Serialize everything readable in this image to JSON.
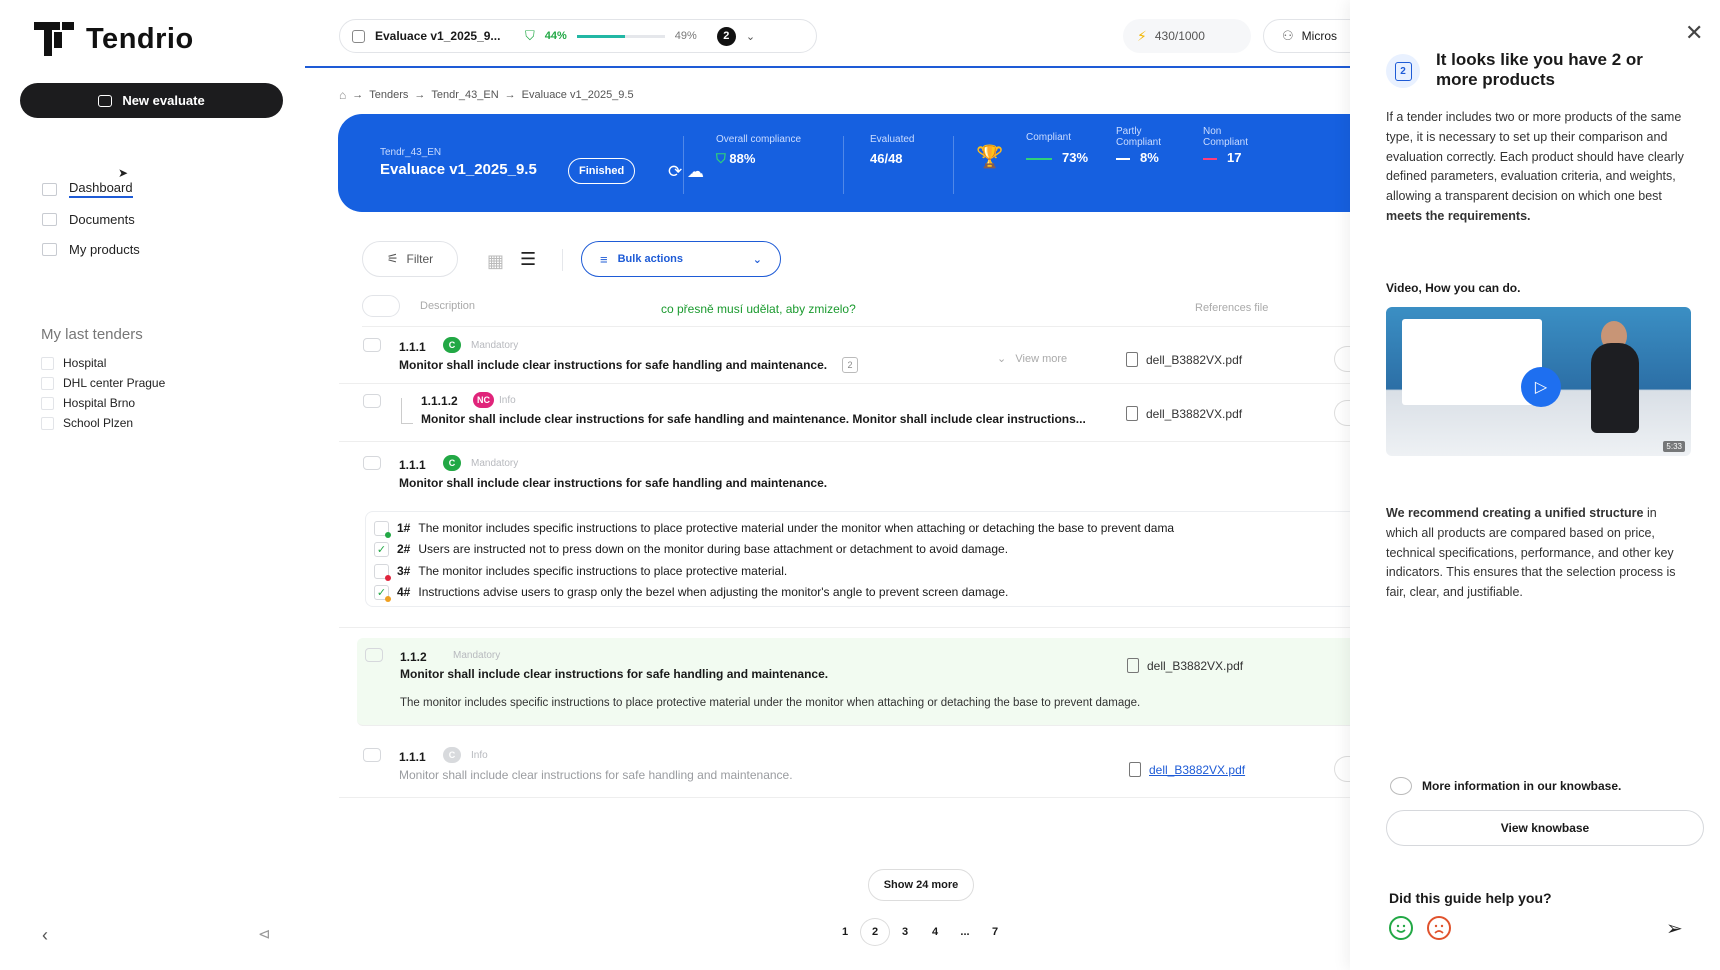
{
  "sidebar": {
    "logo_text": "Tendrio",
    "new_button": "New evaluate",
    "nav": [
      {
        "label": "Dashboard",
        "icon": "dashboard-icon",
        "active": true
      },
      {
        "label": "Documents",
        "icon": "layers-icon",
        "active": false
      },
      {
        "label": "My products",
        "icon": "cart-icon",
        "active": false
      }
    ],
    "section_title": "My last tenders",
    "tenders": [
      "Hospital",
      "DHL center Prague",
      "Hospital Brno",
      "School Plzen"
    ],
    "collapse_icon": "chevron-left-icon",
    "announce_icon": "megaphone-icon"
  },
  "topbar": {
    "eval_name": "Evaluace v1_2025_9...",
    "compliance_pct": "44%",
    "progress_fraction": 0.55,
    "progress_pct": "49%",
    "badge": "2",
    "credits": "430/1000",
    "user": "Micros"
  },
  "breadcrumb": [
    "Tenders",
    "Tendr_43_EN",
    "Evaluace v1_2025_9.5"
  ],
  "banner": {
    "subtitle": "Tendr_43_EN",
    "title": "Evaluace v1_2025_9.5",
    "status": "Finished",
    "overall_label": "Overall compliance",
    "overall_value": "88%",
    "evaluated_label": "Evaluated",
    "evaluated_value": "46/48",
    "compliant_label": "Compliant",
    "compliant_value": "73%",
    "partly_label": "Partly Compliant",
    "partly_value": "8%",
    "non_label": "Non Compliant",
    "non_value": "17",
    "colors": {
      "compliant": "#2fd07a",
      "partly": "#ffffff",
      "non": "#ff3d7a"
    }
  },
  "toolbar": {
    "filter": "Filter",
    "bulk": "Bulk actions"
  },
  "list_header": {
    "description": "Description",
    "references": "References file",
    "note": "co přesně musí udělat, aby zmizelo?"
  },
  "rows": [
    {
      "num": "1.1.1",
      "tag": "C",
      "kind": "Mandatory",
      "text": "Monitor shall include clear instructions for safe handling and maintenance.",
      "count": "2",
      "view_more": "View more",
      "file": "dell_B3882VX.pdf"
    },
    {
      "num": "1.1.1.2",
      "tag": "NC",
      "kind": "Info",
      "text": "Monitor shall include clear instructions for safe handling and maintenance. Monitor shall include clear instructions...",
      "file": "dell_B3882VX.pdf"
    },
    {
      "num": "1.1.1",
      "tag": "C",
      "kind": "Mandatory",
      "text": "Monitor shall include clear instructions for safe handling and maintenance."
    },
    {
      "num": "1.1.2",
      "kind": "Mandatory",
      "text": "Monitor shall include clear instructions for safe handling and maintenance.",
      "detail": "The monitor includes specific instructions to place protective material under the monitor when attaching or detaching the base to prevent damage.",
      "file": "dell_B3882VX.pdf"
    },
    {
      "num": "1.1.1",
      "tag": "C",
      "kind": "Info",
      "text": "Monitor shall include clear instructions for safe handling and maintenance.",
      "file": "dell_B3882VX.pdf"
    }
  ],
  "sub_items": [
    {
      "num": "1#",
      "text": "The monitor includes specific instructions to place protective material under the monitor when attaching or detaching the base to prevent dama",
      "checked": false,
      "dot": "#22a845"
    },
    {
      "num": "2#",
      "text": "Users are instructed not to press down on the monitor during base attachment or detachment to avoid damage.",
      "checked": true,
      "dot": ""
    },
    {
      "num": "3#",
      "text": "The monitor includes specific instructions to place protective material.",
      "checked": false,
      "dot": "#e0243c"
    },
    {
      "num": "4#",
      "text": "Instructions advise users to grasp only the bezel when adjusting the monitor's angle to prevent screen damage.",
      "checked": true,
      "dot": "#f0a020"
    }
  ],
  "pagination": {
    "show_more": "Show 24 more",
    "pages": [
      "1",
      "2",
      "3",
      "4",
      "...",
      "7"
    ],
    "current": "2"
  },
  "panel": {
    "number": "2",
    "title": "It looks like you have 2 or more products",
    "para1_text": "If a tender includes two or more products of the same type, it is necessary to set up their comparison and evaluation correctly. Each product should have clearly defined parameters, evaluation criteria, and weights, allowing a transparent decision on which one best ",
    "para1_bold": "meets the requirements.",
    "video_title": "Video, How you can do.",
    "video_duration": "5:33",
    "para2_bold": "We recommend creating a unified structure",
    "para2_text": " in which all products are compared based on price, technical specifications, performance, and other key indicators. This ensures that the selection process is fair, clear, and justifiable.",
    "more_info": "More information in our knowbase.",
    "kb_button": "View knowbase",
    "help_q": "Did this guide help you?"
  }
}
